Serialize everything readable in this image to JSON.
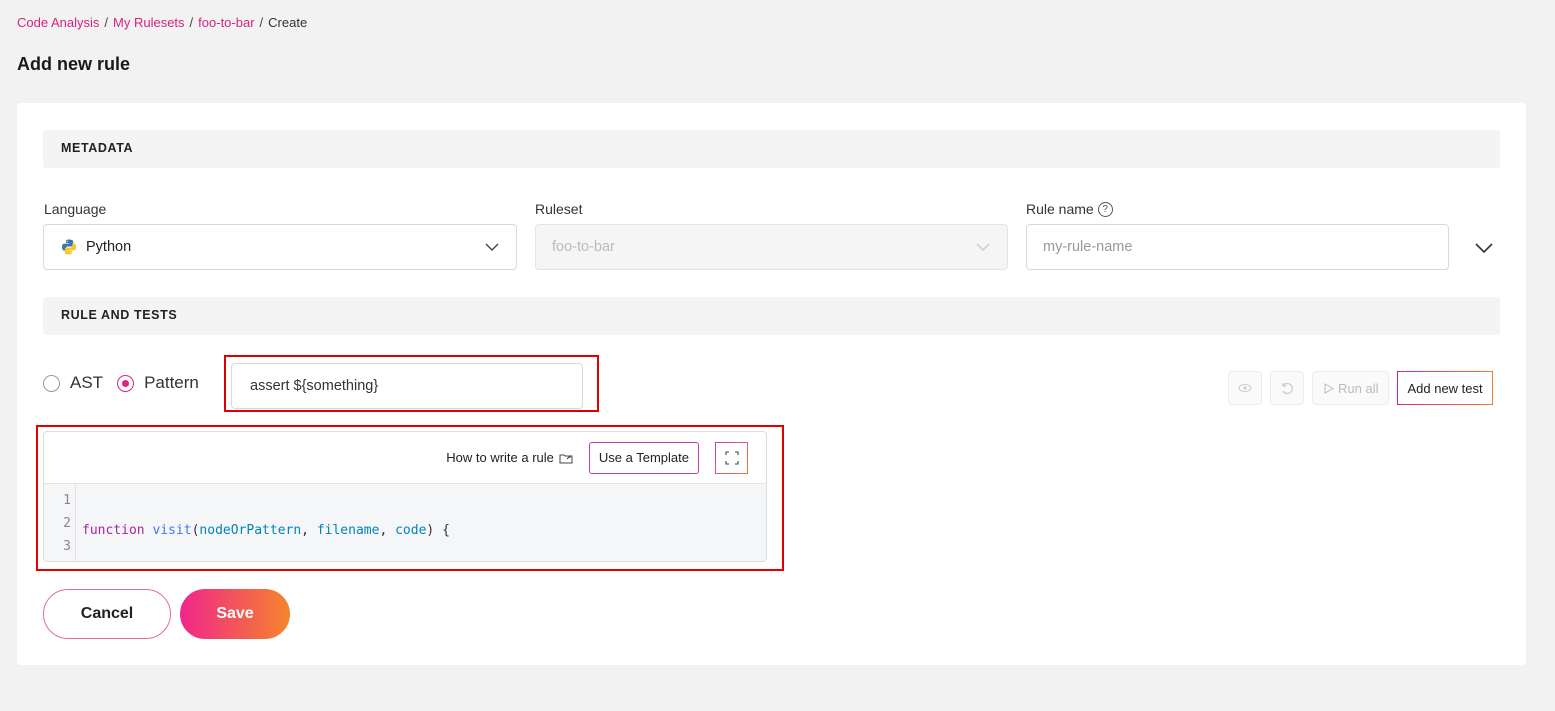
{
  "breadcrumb": {
    "items": [
      "Code Analysis",
      "My Rulesets",
      "foo-to-bar"
    ],
    "current": "Create",
    "separator": "/"
  },
  "page": {
    "title": "Add new rule"
  },
  "metadata": {
    "section_title": "METADATA",
    "language": {
      "label": "Language",
      "value": "Python",
      "icon": "python-icon"
    },
    "ruleset": {
      "label": "Ruleset",
      "value": "foo-to-bar",
      "disabled": true
    },
    "rule_name": {
      "label": "Rule name",
      "placeholder": "my-rule-name",
      "value": ""
    }
  },
  "rule_tests": {
    "section_title": "RULE AND TESTS",
    "mode_options": [
      {
        "label": "AST",
        "checked": false
      },
      {
        "label": "Pattern",
        "checked": true
      }
    ],
    "pattern_value": "assert ${something}",
    "run_all_label": "Run all",
    "add_test_label": "Add new test"
  },
  "editor": {
    "howto_label": "How to write a rule",
    "template_label": "Use a Template",
    "line_numbers": [
      "1",
      "2",
      "3"
    ]
  },
  "actions": {
    "cancel_label": "Cancel",
    "save_label": "Save"
  },
  "colors": {
    "accent": "#e0247a",
    "accent_end": "#f6842c",
    "highlight": "#e00000"
  }
}
